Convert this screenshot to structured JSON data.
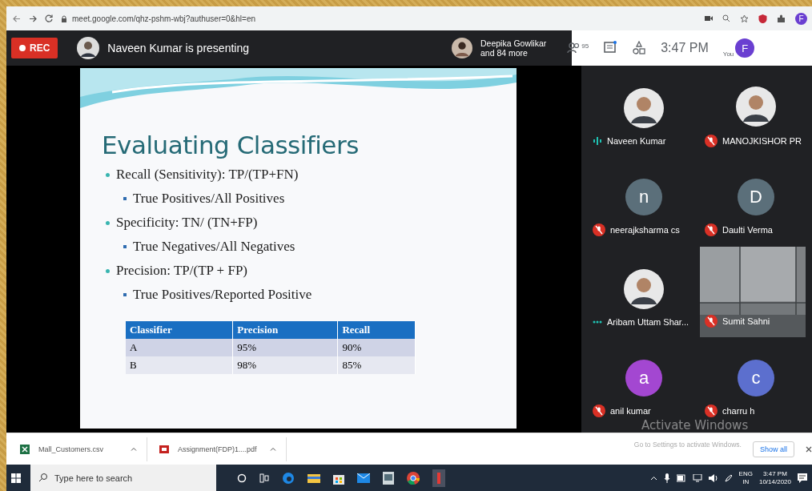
{
  "browser": {
    "url": "meet.google.com/qhz-pshm-wbj?authuser=0&hl=en",
    "profile": "F"
  },
  "meet_bar": {
    "rec": "REC",
    "presenting": "Naveen Kumar is presenting",
    "others_name": "Deepika Gowlikar",
    "others_more": "and 84 more",
    "people_count": "95",
    "time": "3:47 PM",
    "you": "You",
    "avatar": "F"
  },
  "slide": {
    "title": "Evaluating Classifiers",
    "bullets": [
      {
        "text": "Recall (Sensitivity): TP/(TP+FN)",
        "children": [
          {
            "text": "True Positives/All Positives"
          }
        ]
      },
      {
        "text": "Specificity: TN/ (TN+FP)",
        "children": [
          {
            "text": "True Negatives/All Negatives"
          }
        ]
      },
      {
        "text": "Precision: TP/(TP + FP)",
        "children": [
          {
            "text": "True Positives/Reported Positive"
          }
        ]
      }
    ],
    "table": {
      "columns": [
        "Classifier",
        "Precision",
        "Recall"
      ],
      "rows": [
        [
          "A",
          "95%",
          "90%"
        ],
        [
          "B",
          "98%",
          "85%"
        ]
      ]
    }
  },
  "participants": [
    {
      "name": "Naveen Kumar",
      "muted": false,
      "speaking": true
    },
    {
      "name": "MANOJKISHOR PR",
      "muted": true
    },
    {
      "name": "neerajksharma cs",
      "kind": "letter",
      "letter": "n",
      "color": "#5b6f7a",
      "muted": true
    },
    {
      "name": "Daulti Verma",
      "kind": "letter",
      "letter": "D",
      "color": "#5b6f7a",
      "muted": true
    },
    {
      "name": "Aribam Uttam Shar...",
      "muted": false,
      "speaking": false
    },
    {
      "name": "Sumit Sahni",
      "kind": "video",
      "muted": true
    },
    {
      "name": "anil kumar",
      "kind": "letter",
      "letter": "a",
      "color": "#a347d1",
      "muted": true
    },
    {
      "name": "charru h",
      "kind": "letter",
      "letter": "c",
      "color": "#5c6fce",
      "muted": true
    }
  ],
  "activation": {
    "title": "Activate Windows",
    "hint": "Go to Settings to activate Windows."
  },
  "downloads": {
    "items": [
      {
        "name": "Mall_Customers.csv",
        "kind": "csv"
      },
      {
        "name": "Assignment(FDP)1....pdf",
        "kind": "pdf"
      }
    ],
    "show_all": "Show all"
  },
  "taskbar": {
    "search_placeholder": "Type here to search",
    "lang": "ENG",
    "region": "IN",
    "time": "3:47 PM",
    "date": "10/14/2020"
  }
}
